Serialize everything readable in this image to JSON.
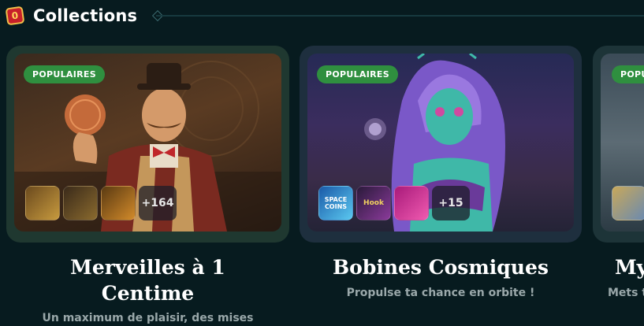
{
  "header": {
    "title": "Collections",
    "icon": "collections-icon"
  },
  "cards": [
    {
      "badge": "POPULAIRES",
      "more": "+164",
      "title": "Merveilles à 1 Centime",
      "subtitle": "Un maximum de plaisir, des mises"
    },
    {
      "badge": "POPULAIRES",
      "more": "+15",
      "title": "Bobines Cosmiques",
      "subtitle": "Propulse ta chance en orbite !",
      "thumb_texts": [
        "SPACE COINS",
        "Hook"
      ]
    },
    {
      "badge": "POPU",
      "title": "My",
      "subtitle": "Mets t"
    }
  ],
  "colors": {
    "badge": "#2f8f3f",
    "background": "#071b1f",
    "header_icon": "#c8202a"
  }
}
